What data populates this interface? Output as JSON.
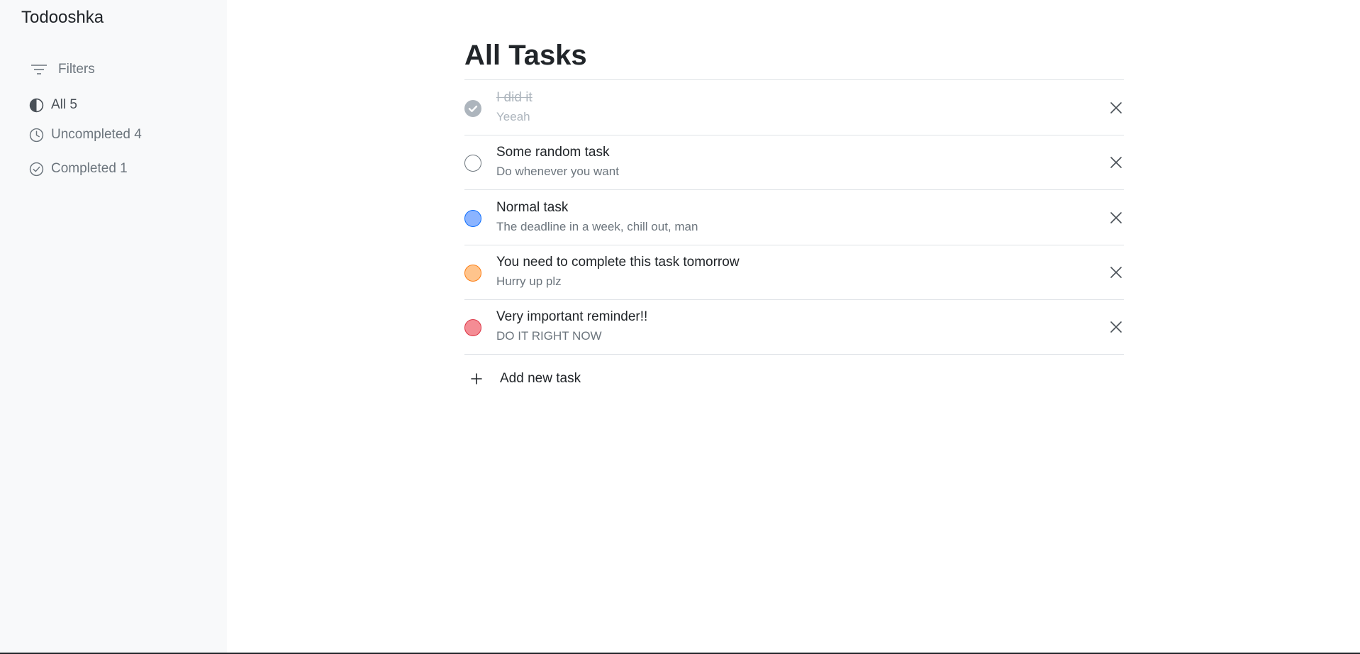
{
  "app": {
    "title": "Todooshka"
  },
  "sidebar": {
    "filters_label": "Filters",
    "items": [
      {
        "label": "All 5",
        "icon": "half-circle-icon"
      },
      {
        "label": "Uncompleted 4",
        "icon": "clock-icon"
      },
      {
        "label": "Completed 1",
        "icon": "check-circle-icon"
      }
    ]
  },
  "main": {
    "title": "All Tasks",
    "tasks": [
      {
        "title": "I did it",
        "description": "Yeeah",
        "state": "completed",
        "color": "#adb5bd"
      },
      {
        "title": "Some random task",
        "description": "Do whenever you want",
        "priority": "none",
        "color": "#ffffff",
        "border": "#6c757d"
      },
      {
        "title": "Normal task",
        "description": "The deadline in a week, chill out, man",
        "priority": "normal",
        "color": "#8bb4ff",
        "border": "#0d6efd"
      },
      {
        "title": "You need to complete this task tomorrow",
        "description": "Hurry up plz",
        "priority": "high",
        "color": "#ffc48c",
        "border": "#fd7e14"
      },
      {
        "title": "Very important reminder!!",
        "description": "DO IT RIGHT NOW",
        "priority": "critical",
        "color": "#f48c94",
        "border": "#dc3545"
      }
    ],
    "add_label": "Add new task"
  }
}
